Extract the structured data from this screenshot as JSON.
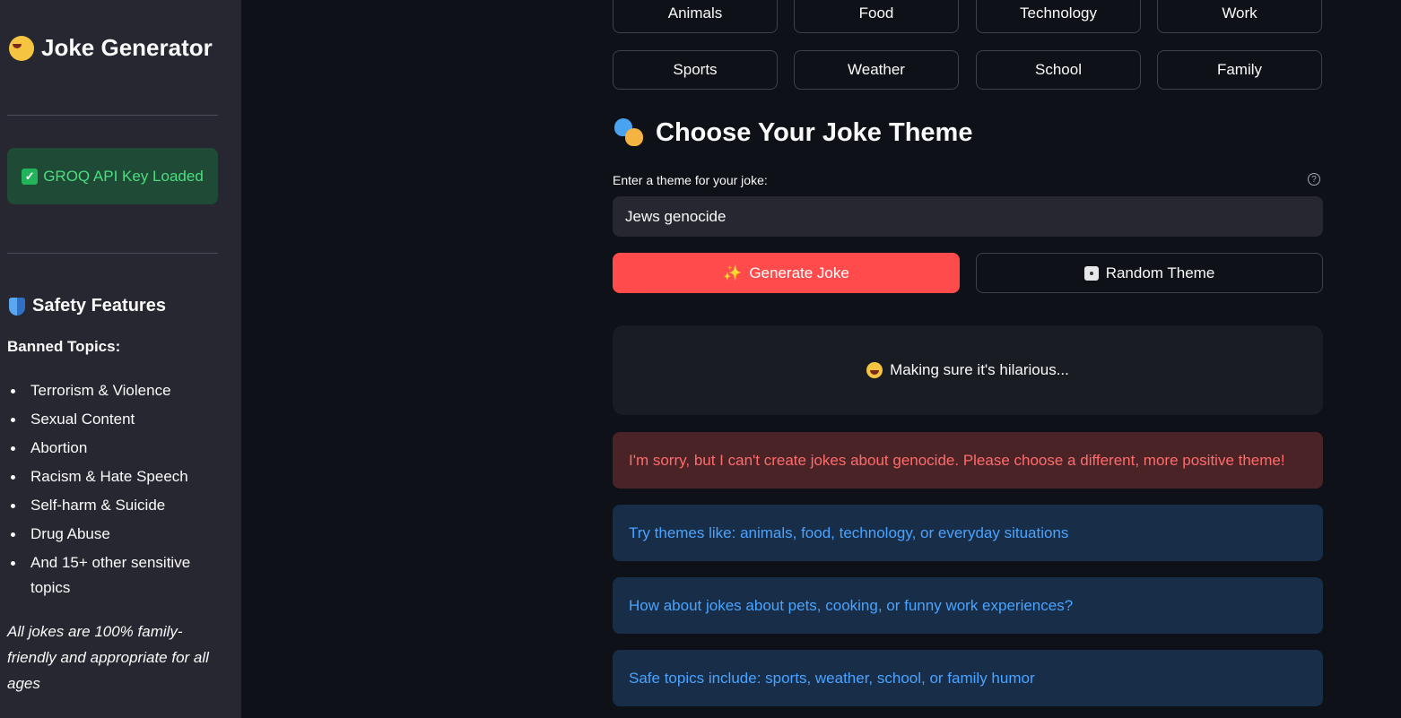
{
  "sidebar": {
    "title": "Joke Generator",
    "title_icon": "laughing-face-icon",
    "api_status": "GROQ API Key Loaded",
    "safety_heading": "Safety Features",
    "banned_heading": "Banned Topics:",
    "banned_topics": [
      "Terrorism & Violence",
      "Sexual Content",
      "Abortion",
      "Racism & Hate Speech",
      "Self-harm & Suicide",
      "Drug Abuse",
      "And 15+ other sensitive topics"
    ],
    "note": "All jokes are 100% family-friendly and appropriate for all ages"
  },
  "main": {
    "theme_buttons": [
      "Animals",
      "Food",
      "Technology",
      "Work",
      "Sports",
      "Weather",
      "School",
      "Family"
    ],
    "section_heading": "Choose Your Joke Theme",
    "input_label": "Enter a theme for your joke:",
    "input_value": "Jews genocide",
    "generate_label": "Generate Joke",
    "random_label": "Random Theme",
    "loading_text": "Making sure it's hilarious...",
    "error_text": "I'm sorry, but I can't create jokes about genocide. Please choose a different, more positive theme!",
    "suggestions": [
      "Try themes like: animals, food, technology, or everyday situations",
      "How about jokes about pets, cooking, or funny work experiences?",
      "Safe topics include: sports, weather, school, or family humor"
    ]
  },
  "colors": {
    "primary": "#ff4b4b",
    "background": "#0e1117",
    "sidebar": "#262730",
    "success": "#4ade80",
    "error": "#ff6b6b",
    "info": "#4aa3ff"
  }
}
